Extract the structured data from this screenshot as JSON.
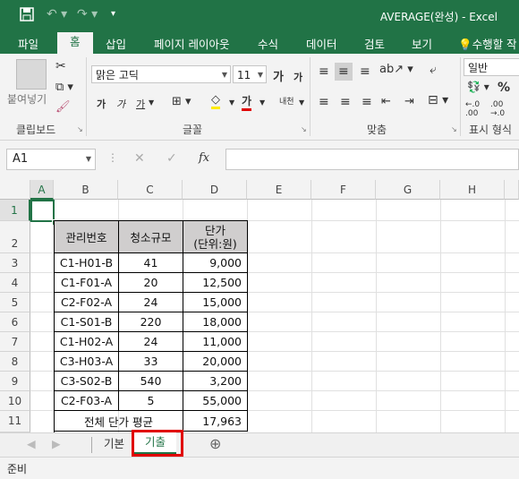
{
  "window": {
    "title": "AVERAGE(완성) - Excel"
  },
  "quick_access": {
    "save_icon": "save-icon",
    "undo_icon": "undo-icon",
    "redo_icon": "redo-icon",
    "customize_icon": "customize-icon"
  },
  "ribbon_tabs": [
    "파일",
    "홈",
    "삽입",
    "페이지 레이아웃",
    "수식",
    "데이터",
    "검토",
    "보기",
    "수행할 작"
  ],
  "active_tab": "홈",
  "ribbon": {
    "clipboard": {
      "paste": "붙여넣기",
      "label": "클립보드"
    },
    "font": {
      "name": "맑은 고딕",
      "size": "11",
      "grow": "가",
      "shrink": "가",
      "bold": "가",
      "italic": "가",
      "underline": "가",
      "font_color": "가",
      "phonetic": "내천",
      "label": "글꼴"
    },
    "alignment": {
      "label": "맞춤"
    },
    "number": {
      "format": "일반",
      "percent": "%",
      "label": "표시 형식"
    }
  },
  "formula_bar": {
    "name_box": "A1",
    "cancel": "✕",
    "enter": "✓",
    "fx": "fx",
    "value": ""
  },
  "columns": [
    "A",
    "B",
    "C",
    "D",
    "E",
    "F",
    "G",
    "H"
  ],
  "rows": [
    "1",
    "2",
    "3",
    "4",
    "5",
    "6",
    "7",
    "8",
    "9",
    "10",
    "11"
  ],
  "table": {
    "headers": [
      "관리번호",
      "청소규모",
      "단가\n(단위:원)"
    ],
    "rows": [
      [
        "C1-H01-B",
        "41",
        "9,000"
      ],
      [
        "C1-F01-A",
        "20",
        "12,500"
      ],
      [
        "C2-F02-A",
        "24",
        "15,000"
      ],
      [
        "C1-S01-B",
        "220",
        "18,000"
      ],
      [
        "C1-H02-A",
        "24",
        "11,000"
      ],
      [
        "C3-H03-A",
        "33",
        "20,000"
      ],
      [
        "C3-S02-B",
        "540",
        "3,200"
      ],
      [
        "C2-F03-A",
        "5",
        "55,000"
      ]
    ],
    "summary_label": "전체 단가 평균",
    "summary_value": "17,963"
  },
  "sheets": {
    "tabs": [
      "기본",
      "기출"
    ],
    "active": "기출",
    "add": "⊕"
  },
  "status": {
    "text": "준비"
  },
  "colors": {
    "excel_green": "#217346",
    "header_fill": "#d0cece",
    "highlight": "#e00000"
  }
}
